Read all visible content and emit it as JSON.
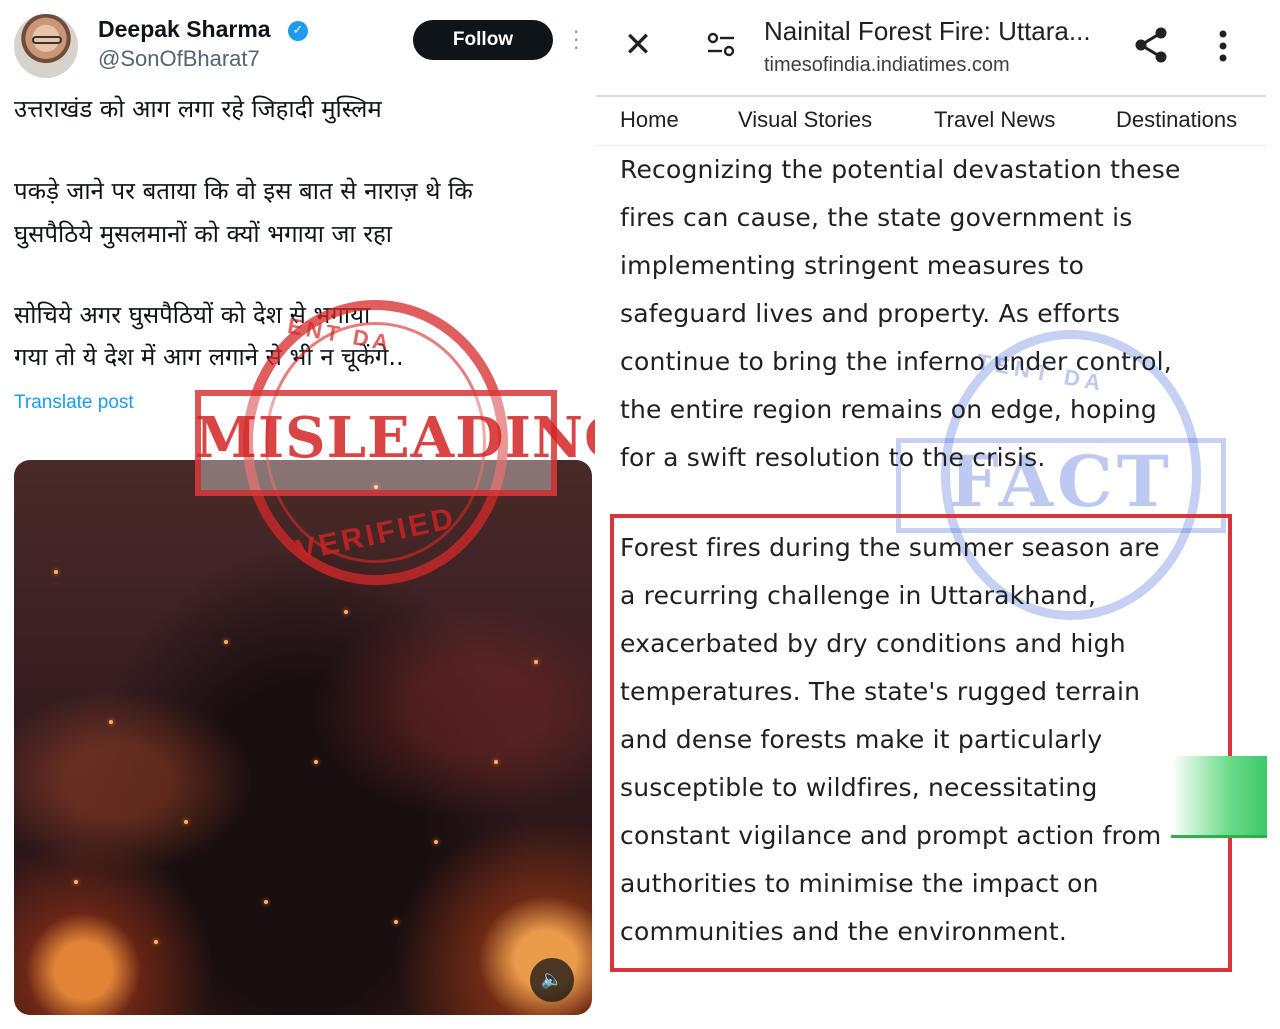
{
  "tweet": {
    "display_name": "Deepak Sharma",
    "handle": "@SonOfBharat7",
    "follow_label": "Follow",
    "lines": [
      "उत्तराखंड को आग लगा रहे जिहादी मुस्लिम",
      "पकड़े जाने पर बताया कि वो इस बात से नाराज़ थे कि",
      "घुसपैठिये मुसलमानों को क्यों भगाया जा रहा",
      "सोचिये अगर घुसपैठियों को देश से भगाया",
      "गया तो ये देश में आग लगाने से भी न चूकेंगे.."
    ],
    "translate_label": "Translate post"
  },
  "misleading_stamp": {
    "label": "MISLEADING",
    "bottom_text": "VERIFIED",
    "top_text": "ENT DA"
  },
  "browser": {
    "title": "Nainital Forest Fire: Uttara...",
    "domain": "timesofindia.indiatimes.com"
  },
  "nav": {
    "items": [
      "Home",
      "Visual Stories",
      "Travel News",
      "Destinations"
    ]
  },
  "article": {
    "para1_lines": [
      "Recognizing the potential devastation these",
      "fires can cause, the state government is",
      "implementing stringent measures to",
      "safeguard lives and property. As efforts",
      "continue to bring the inferno under control,",
      "the entire region remains on edge, hoping",
      "for a swift resolution to the crisis."
    ],
    "para2_lines": [
      "Forest fires during the summer season are",
      "a recurring challenge in Uttarakhand,",
      "exacerbated by dry conditions and high",
      "temperatures. The state's rugged terrain",
      "and dense forests make it particularly",
      "susceptible to wildfires, necessitating",
      "constant vigilance and prompt action from",
      "authorities to minimise the impact on",
      "communities and the environment."
    ]
  },
  "fact_stamp": {
    "label": "FACT",
    "top_text": "TENT DA"
  },
  "icons": {
    "verified": "verified-badge-icon",
    "more": "more-vertical-icon",
    "sound": "speaker-icon",
    "close": "close-icon",
    "settings": "site-settings-icon",
    "share": "share-icon",
    "menu": "menu-kebab-icon"
  },
  "colors": {
    "accent_blue": "#1d9bf0",
    "misleading_red": "#d62828",
    "highlight_red": "#d9343b",
    "fact_blue": "#5a78dc"
  }
}
